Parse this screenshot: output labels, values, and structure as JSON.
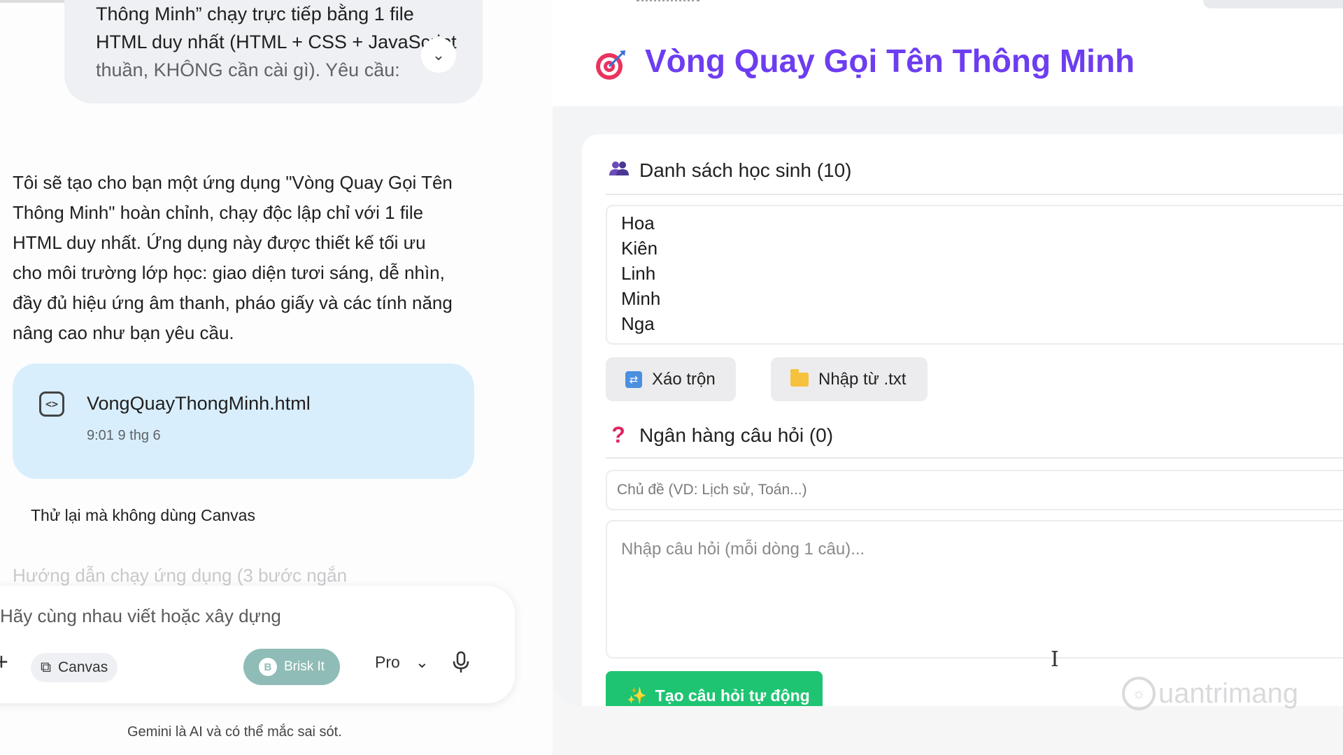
{
  "chat": {
    "user_message_lines": [
      "Thông Minh” chạy trực tiếp bằng 1 file",
      "HTML duy nhất (HTML + CSS + JavaScript",
      "thuần, KHÔNG cần cài gì). Yêu cầu:"
    ],
    "expand_icon": "chevron-down-icon",
    "response_lines": [
      "Tôi sẽ tạo cho bạn một ứng dụng \"Vòng Quay Gọi Tên",
      "Thông Minh\" hoàn chỉnh, chạy độc lập chỉ với 1 file",
      "HTML duy nhất. Ứng dụng này được thiết kế tối ưu",
      "cho môi trường lớp học: giao diện tươi sáng, dễ nhìn,",
      "đầy đủ hiệu ứng âm thanh, pháo giấy và các tính năng",
      "nâng cao như bạn yêu cầu."
    ],
    "file_card": {
      "icon": "code-icon",
      "name": "VongQuayThongMinh.html",
      "time": "9:01 9 thg 6"
    },
    "retry_label": "Thử lại mà không dùng Canvas",
    "faded_text": "Hướng dẫn chạy ứng dụng (3 bước ngắn",
    "composer": {
      "placeholder": "Hãy cùng nhau viết hoặc xây dựng",
      "plus_icon": "plus-icon",
      "canvas_label": "Canvas",
      "brisk_label": "Brisk It",
      "model_label": "Pro",
      "mic_icon": "mic-icon"
    },
    "disclaimer": "Gemini là AI và có thể mắc sai sót."
  },
  "app": {
    "title": "Vòng Quay Gọi Tên Thông Minh",
    "title_icon": "target-icon",
    "accent_color": "#6d3df0",
    "students": {
      "title": "Danh sách học sinh (10)",
      "icon": "people-icon",
      "visible_names": [
        "Hoa",
        "Kiên",
        "Linh",
        "Minh",
        "Nga"
      ]
    },
    "buttons": {
      "shuffle": "Xáo trộn",
      "import": "Nhập từ .txt"
    },
    "questions": {
      "title": "Ngân hàng câu hỏi (0)",
      "icon": "question-icon",
      "topic_placeholder": "Chủ đề (VD: Lịch sử, Toán...)",
      "questions_placeholder": "Nhập câu hỏi (mỗi dòng 1 câu)...",
      "generate_label": "Tạo câu hỏi tự động",
      "generate_color": "#1ec472"
    }
  },
  "watermark": "uantrimang"
}
